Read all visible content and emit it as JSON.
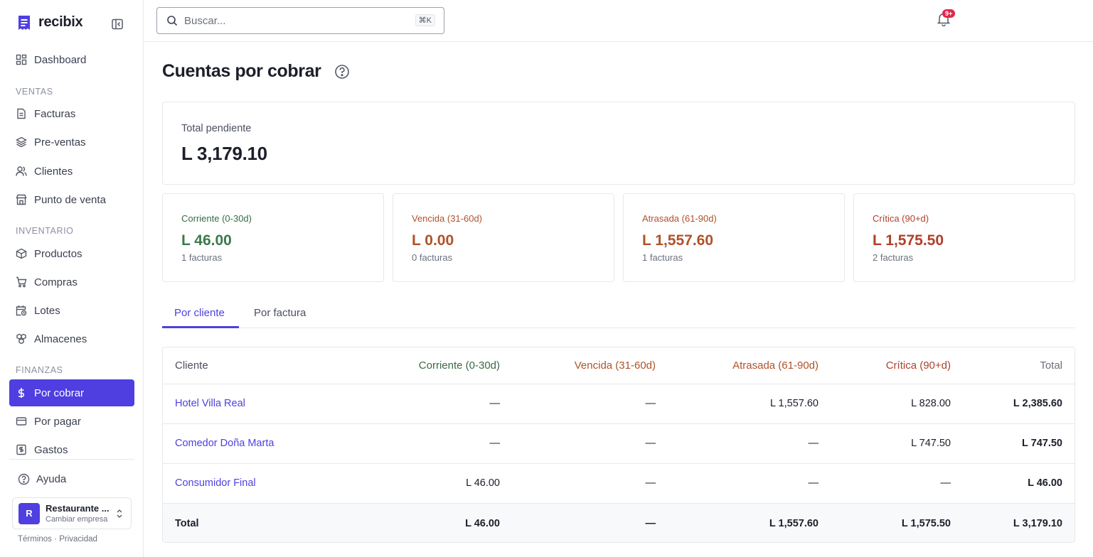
{
  "brand": {
    "name": "recibix"
  },
  "sidebar": {
    "items": [
      {
        "label": "Dashboard"
      },
      {
        "section": "VENTAS"
      },
      {
        "label": "Facturas"
      },
      {
        "label": "Pre-ventas"
      },
      {
        "label": "Clientes"
      },
      {
        "label": "Punto de venta"
      },
      {
        "section": "INVENTARIO"
      },
      {
        "label": "Productos"
      },
      {
        "label": "Compras"
      },
      {
        "label": "Lotes"
      },
      {
        "label": "Almacenes"
      },
      {
        "section": "FINANZAS"
      },
      {
        "label": "Por cobrar",
        "active": true
      },
      {
        "label": "Por pagar"
      },
      {
        "label": "Gastos"
      }
    ],
    "help_label": "Ayuda",
    "company": {
      "avatar_letter": "R",
      "name": "Restaurante ...",
      "action": "Cambiar empresa"
    },
    "footer": {
      "terms": "Términos",
      "separator": "·",
      "privacy": "Privacidad"
    }
  },
  "topbar": {
    "search_placeholder": "Buscar...",
    "search_shortcut": "⌘K",
    "notifications_badge": "9+"
  },
  "page": {
    "title": "Cuentas por cobrar",
    "total": {
      "label": "Total pendiente",
      "value": "L 3,179.10"
    },
    "buckets": [
      {
        "label": "Corriente (0-30d)",
        "value": "L 46.00",
        "count": "1 facturas",
        "color": "#3a7a4c"
      },
      {
        "label": "Vencida (31-60d)",
        "value": "L 0.00",
        "count": "0 facturas",
        "color": "#b0522a"
      },
      {
        "label": "Atrasada (61-90d)",
        "value": "L 1,557.60",
        "count": "1 facturas",
        "color": "#b0522a"
      },
      {
        "label": "Crítica (90+d)",
        "value": "L 1,575.50",
        "count": "2 facturas",
        "color": "#b0402a"
      }
    ],
    "tabs": [
      {
        "label": "Por cliente",
        "active": true
      },
      {
        "label": "Por factura",
        "active": false
      }
    ],
    "table": {
      "headers": [
        "Cliente",
        "Corriente (0-30d)",
        "Vencida (31-60d)",
        "Atrasada (61-90d)",
        "Crítica (90+d)",
        "Total"
      ],
      "rows": [
        [
          "Hotel Villa Real",
          "—",
          "—",
          "L 1,557.60",
          "L 828.00",
          "L 2,385.60"
        ],
        [
          "Comedor Doña Marta",
          "—",
          "—",
          "—",
          "L 747.50",
          "L 747.50"
        ],
        [
          "Consumidor Final",
          "L 46.00",
          "—",
          "—",
          "—",
          "L 46.00"
        ]
      ],
      "total_row": [
        "Total",
        "L 46.00",
        "—",
        "L 1,557.60",
        "L 1,575.50",
        "L 3,179.10"
      ]
    }
  },
  "colors": {
    "accent": "#4f3fe0",
    "current": "#3a7a4c",
    "overdue": "#b0522a",
    "badge": "#e0284a"
  }
}
